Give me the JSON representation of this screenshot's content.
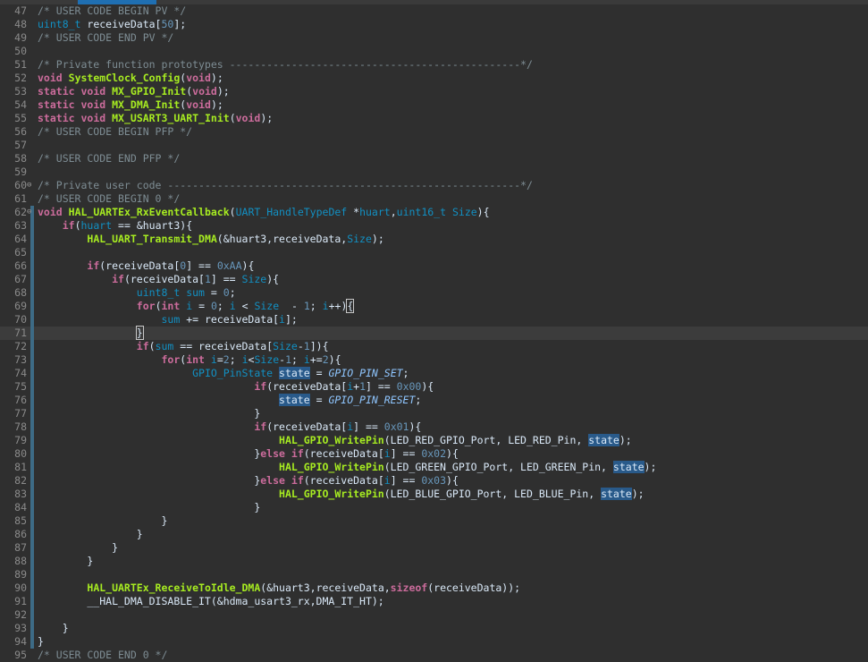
{
  "editor": {
    "lines": [
      {
        "n": "47",
        "parts": [
          [
            "/* USER CODE BEGIN PV */",
            "cm"
          ]
        ]
      },
      {
        "n": "48",
        "parts": [
          [
            "uint8_t",
            "ty"
          ],
          [
            " receiveData[",
            ""
          ],
          [
            "50",
            "nm"
          ],
          [
            "];",
            ""
          ]
        ]
      },
      {
        "n": "49",
        "parts": [
          [
            "/* USER CODE END PV */",
            "cm"
          ]
        ]
      },
      {
        "n": "50",
        "parts": []
      },
      {
        "n": "51",
        "parts": [
          [
            "/* Private function prototypes -----------------------------------------------*/",
            "cm"
          ]
        ]
      },
      {
        "n": "52",
        "parts": [
          [
            "void",
            "kw"
          ],
          [
            " ",
            ""
          ],
          [
            "SystemClock_Config",
            "fn"
          ],
          [
            "(",
            ""
          ],
          [
            "void",
            "kw"
          ],
          [
            ");",
            ""
          ]
        ]
      },
      {
        "n": "53",
        "parts": [
          [
            "static",
            "kw"
          ],
          [
            " ",
            ""
          ],
          [
            "void",
            "kw"
          ],
          [
            " ",
            ""
          ],
          [
            "MX_GPIO_Init",
            "fn"
          ],
          [
            "(",
            ""
          ],
          [
            "void",
            "kw"
          ],
          [
            ");",
            ""
          ]
        ]
      },
      {
        "n": "54",
        "parts": [
          [
            "static",
            "kw"
          ],
          [
            " ",
            ""
          ],
          [
            "void",
            "kw"
          ],
          [
            " ",
            ""
          ],
          [
            "MX_DMA_Init",
            "fn"
          ],
          [
            "(",
            ""
          ],
          [
            "void",
            "kw"
          ],
          [
            ");",
            ""
          ]
        ]
      },
      {
        "n": "55",
        "parts": [
          [
            "static",
            "kw"
          ],
          [
            " ",
            ""
          ],
          [
            "void",
            "kw"
          ],
          [
            " ",
            ""
          ],
          [
            "MX_USART3_UART_Init",
            "fn"
          ],
          [
            "(",
            ""
          ],
          [
            "void",
            "kw"
          ],
          [
            ");",
            ""
          ]
        ]
      },
      {
        "n": "56",
        "parts": [
          [
            "/* USER CODE BEGIN PFP */",
            "cm"
          ]
        ]
      },
      {
        "n": "57",
        "parts": []
      },
      {
        "n": "58",
        "parts": [
          [
            "/* USER CODE END PFP */",
            "cm"
          ]
        ]
      },
      {
        "n": "59",
        "parts": []
      },
      {
        "n": "60",
        "fold": true,
        "parts": [
          [
            "/* Private user code ---------------------------------------------------------*/",
            "cm"
          ]
        ]
      },
      {
        "n": "61",
        "parts": [
          [
            "/* USER CODE BEGIN 0 */",
            "cm"
          ]
        ]
      },
      {
        "n": "62",
        "fold": true,
        "parts": [
          [
            "void",
            "kw"
          ],
          [
            " ",
            ""
          ],
          [
            "HAL_UARTEx_RxEventCallback",
            "fn"
          ],
          [
            "(",
            ""
          ],
          [
            "UART_HandleTypeDef",
            "ty"
          ],
          [
            " *",
            ""
          ],
          [
            "huart",
            "ty"
          ],
          [
            ",",
            ""
          ],
          [
            "uint16_t",
            "ty"
          ],
          [
            " ",
            ""
          ],
          [
            "Size",
            "ty"
          ],
          [
            "){",
            ""
          ]
        ]
      },
      {
        "n": "63",
        "parts": [
          [
            "    ",
            ""
          ],
          [
            "if",
            "kw"
          ],
          [
            "(",
            ""
          ],
          [
            "huart",
            "ty"
          ],
          [
            " == &huart3){",
            ""
          ]
        ]
      },
      {
        "n": "64",
        "parts": [
          [
            "        ",
            ""
          ],
          [
            "HAL_UART_Transmit_DMA",
            "fn"
          ],
          [
            "(&huart3,receiveData,",
            ""
          ],
          [
            "Size",
            "ty"
          ],
          [
            ");",
            ""
          ]
        ]
      },
      {
        "n": "65",
        "parts": []
      },
      {
        "n": "66",
        "parts": [
          [
            "        ",
            ""
          ],
          [
            "if",
            "kw"
          ],
          [
            "(receiveData[",
            ""
          ],
          [
            "0",
            "nm"
          ],
          [
            "] == ",
            ""
          ],
          [
            "0xAA",
            "nm"
          ],
          [
            "){",
            ""
          ]
        ]
      },
      {
        "n": "67",
        "parts": [
          [
            "            ",
            ""
          ],
          [
            "if",
            "kw"
          ],
          [
            "(receiveData[",
            ""
          ],
          [
            "1",
            "nm"
          ],
          [
            "] == ",
            ""
          ],
          [
            "Size",
            "ty"
          ],
          [
            "){",
            ""
          ]
        ]
      },
      {
        "n": "68",
        "parts": [
          [
            "                ",
            ""
          ],
          [
            "uint8_t",
            "ty"
          ],
          [
            " ",
            ""
          ],
          [
            "sum",
            "ty"
          ],
          [
            " = ",
            ""
          ],
          [
            "0",
            "nm"
          ],
          [
            ";",
            ""
          ]
        ]
      },
      {
        "n": "69",
        "parts": [
          [
            "                ",
            ""
          ],
          [
            "for",
            "kw"
          ],
          [
            "(",
            ""
          ],
          [
            "int",
            "kw"
          ],
          [
            " ",
            ""
          ],
          [
            "i",
            "ty"
          ],
          [
            " = ",
            ""
          ],
          [
            "0",
            "nm"
          ],
          [
            "; ",
            ""
          ],
          [
            "i",
            "ty"
          ],
          [
            " < ",
            ""
          ],
          [
            "Size",
            "ty"
          ],
          [
            "  - ",
            ""
          ],
          [
            "1",
            "nm"
          ],
          [
            "; ",
            ""
          ],
          [
            "i",
            "ty"
          ],
          [
            "++)",
            ""
          ],
          [
            "{",
            "brk"
          ]
        ]
      },
      {
        "n": "70",
        "parts": [
          [
            "                    ",
            ""
          ],
          [
            "sum",
            "ty"
          ],
          [
            " += receiveData[",
            ""
          ],
          [
            "i",
            "ty"
          ],
          [
            "];",
            ""
          ]
        ]
      },
      {
        "n": "71",
        "hl": true,
        "parts": [
          [
            "                ",
            ""
          ],
          [
            "}",
            "brk"
          ],
          [
            "",
            "caret"
          ]
        ]
      },
      {
        "n": "72",
        "parts": [
          [
            "                ",
            ""
          ],
          [
            "if",
            "kw"
          ],
          [
            "(",
            ""
          ],
          [
            "sum",
            "ty"
          ],
          [
            " == receiveData[",
            ""
          ],
          [
            "Size",
            "ty"
          ],
          [
            "-",
            ""
          ],
          [
            "1",
            "nm"
          ],
          [
            "]){",
            ""
          ]
        ]
      },
      {
        "n": "73",
        "parts": [
          [
            "                    ",
            ""
          ],
          [
            "for",
            "kw"
          ],
          [
            "(",
            ""
          ],
          [
            "int",
            "kw"
          ],
          [
            " ",
            ""
          ],
          [
            "i",
            "ty"
          ],
          [
            "=",
            ""
          ],
          [
            "2",
            "nm"
          ],
          [
            "; ",
            ""
          ],
          [
            "i",
            "ty"
          ],
          [
            "<",
            ""
          ],
          [
            "Size",
            "ty"
          ],
          [
            "-",
            ""
          ],
          [
            "1",
            "nm"
          ],
          [
            "; ",
            ""
          ],
          [
            "i",
            "ty"
          ],
          [
            "+=",
            ""
          ],
          [
            "2",
            "nm"
          ],
          [
            "){",
            ""
          ]
        ]
      },
      {
        "n": "74",
        "parts": [
          [
            "                         ",
            ""
          ],
          [
            "GPIO_PinState",
            "ty"
          ],
          [
            " ",
            ""
          ],
          [
            "state",
            "sel"
          ],
          [
            " = ",
            ""
          ],
          [
            "GPIO_PIN_SET",
            "mc"
          ],
          [
            ";",
            ""
          ]
        ]
      },
      {
        "n": "75",
        "parts": [
          [
            "                                   ",
            ""
          ],
          [
            "if",
            "kw"
          ],
          [
            "(receiveData[",
            ""
          ],
          [
            "i",
            "ty"
          ],
          [
            "+",
            ""
          ],
          [
            "1",
            "nm"
          ],
          [
            "] == ",
            ""
          ],
          [
            "0x00",
            "nm"
          ],
          [
            "){",
            ""
          ]
        ]
      },
      {
        "n": "76",
        "parts": [
          [
            "                                       ",
            ""
          ],
          [
            "state",
            "sel"
          ],
          [
            " = ",
            ""
          ],
          [
            "GPIO_PIN_RESET",
            "mc"
          ],
          [
            ";",
            ""
          ]
        ]
      },
      {
        "n": "77",
        "parts": [
          [
            "                                   }",
            ""
          ]
        ]
      },
      {
        "n": "78",
        "parts": [
          [
            "                                   ",
            ""
          ],
          [
            "if",
            "kw"
          ],
          [
            "(receiveData[",
            ""
          ],
          [
            "i",
            "ty"
          ],
          [
            "] == ",
            ""
          ],
          [
            "0x01",
            "nm"
          ],
          [
            "){",
            ""
          ]
        ]
      },
      {
        "n": "79",
        "parts": [
          [
            "                                       ",
            ""
          ],
          [
            "HAL_GPIO_WritePin",
            "fn"
          ],
          [
            "(LED_RED_GPIO_Port, LED_RED_Pin, ",
            ""
          ],
          [
            "state",
            "sel"
          ],
          [
            ");",
            ""
          ]
        ]
      },
      {
        "n": "80",
        "parts": [
          [
            "                                   }",
            ""
          ],
          [
            "else",
            "kw"
          ],
          [
            " ",
            ""
          ],
          [
            "if",
            "kw"
          ],
          [
            "(receiveData[",
            ""
          ],
          [
            "i",
            "ty"
          ],
          [
            "] == ",
            ""
          ],
          [
            "0x02",
            "nm"
          ],
          [
            "){",
            ""
          ]
        ]
      },
      {
        "n": "81",
        "parts": [
          [
            "                                       ",
            ""
          ],
          [
            "HAL_GPIO_WritePin",
            "fn"
          ],
          [
            "(LED_GREEN_GPIO_Port, LED_GREEN_Pin, ",
            ""
          ],
          [
            "state",
            "sel"
          ],
          [
            ");",
            ""
          ]
        ]
      },
      {
        "n": "82",
        "parts": [
          [
            "                                   }",
            ""
          ],
          [
            "else",
            "kw"
          ],
          [
            " ",
            ""
          ],
          [
            "if",
            "kw"
          ],
          [
            "(receiveData[",
            ""
          ],
          [
            "i",
            "ty"
          ],
          [
            "] == ",
            ""
          ],
          [
            "0x03",
            "nm"
          ],
          [
            "){",
            ""
          ]
        ]
      },
      {
        "n": "83",
        "parts": [
          [
            "                                       ",
            ""
          ],
          [
            "HAL_GPIO_WritePin",
            "fn"
          ],
          [
            "(LED_BLUE_GPIO_Port, LED_BLUE_Pin, ",
            ""
          ],
          [
            "state",
            "sel"
          ],
          [
            ");",
            ""
          ]
        ]
      },
      {
        "n": "84",
        "parts": [
          [
            "                                   }",
            ""
          ]
        ]
      },
      {
        "n": "85",
        "parts": [
          [
            "                    }",
            ""
          ]
        ]
      },
      {
        "n": "86",
        "parts": [
          [
            "                }",
            ""
          ]
        ]
      },
      {
        "n": "87",
        "parts": [
          [
            "            }",
            ""
          ]
        ]
      },
      {
        "n": "88",
        "parts": [
          [
            "        }",
            ""
          ]
        ]
      },
      {
        "n": "89",
        "parts": []
      },
      {
        "n": "90",
        "parts": [
          [
            "        ",
            ""
          ],
          [
            "HAL_UARTEx_ReceiveToIdle_DMA",
            "fn"
          ],
          [
            "(&huart3,receiveData,",
            ""
          ],
          [
            "sizeof",
            "kw"
          ],
          [
            "(receiveData));",
            ""
          ]
        ]
      },
      {
        "n": "91",
        "parts": [
          [
            "        __HAL_DMA_DISABLE_IT(&hdma_usart3_rx,DMA_IT_HT);",
            ""
          ]
        ]
      },
      {
        "n": "92",
        "parts": []
      },
      {
        "n": "93",
        "parts": [
          [
            "    }",
            ""
          ]
        ]
      },
      {
        "n": "94",
        "parts": [
          [
            "}",
            ""
          ]
        ]
      },
      {
        "n": "95",
        "parts": [
          [
            "/* USER CODE END 0 */",
            "cm"
          ]
        ]
      }
    ],
    "modified_lines": [
      "62",
      "63",
      "64",
      "65",
      "66",
      "67",
      "68",
      "69",
      "70",
      "71",
      "72",
      "73",
      "74",
      "75",
      "76",
      "77",
      "78",
      "79",
      "80",
      "81",
      "82",
      "83",
      "84",
      "85",
      "86",
      "87",
      "88",
      "89",
      "90",
      "91",
      "92",
      "93",
      "94"
    ]
  }
}
